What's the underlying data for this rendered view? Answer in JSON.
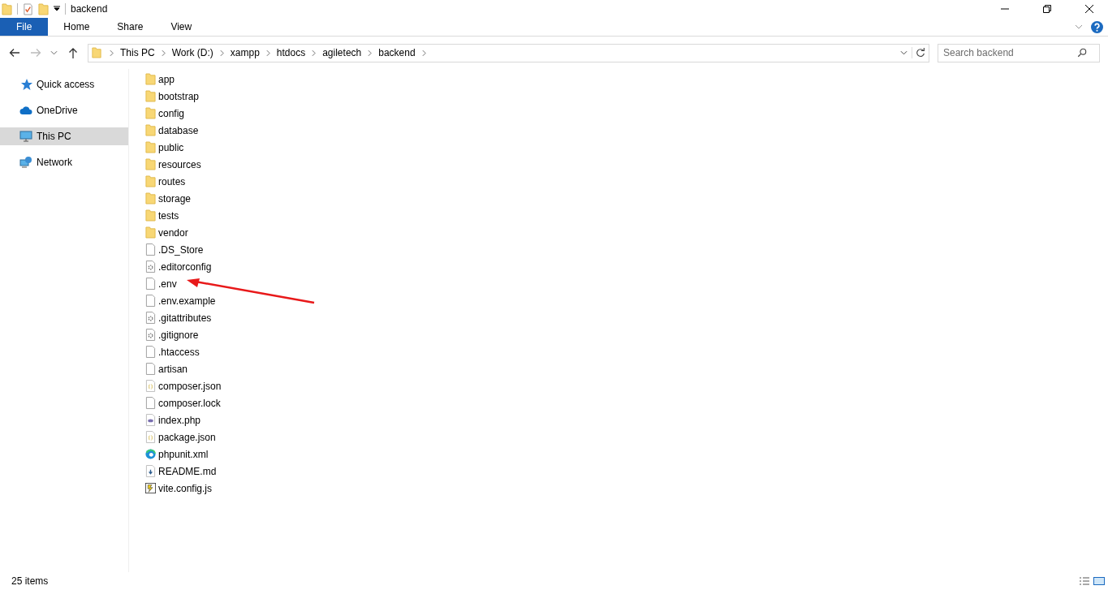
{
  "window": {
    "title": "backend"
  },
  "ribbon_tabs": [
    {
      "label": "File",
      "kind": "menu"
    },
    {
      "label": "Home",
      "kind": "tab"
    },
    {
      "label": "Share",
      "kind": "tab"
    },
    {
      "label": "View",
      "kind": "tab"
    }
  ],
  "address_bar": {
    "path": [
      "This PC",
      "Work (D:)",
      "xampp",
      "htdocs",
      "agiletech",
      "backend"
    ]
  },
  "search": {
    "placeholder": "Search backend"
  },
  "sidebar": {
    "items": [
      {
        "label": "Quick access",
        "kind": "star",
        "selected": false
      },
      {
        "label": "OneDrive",
        "kind": "cloud",
        "selected": false
      },
      {
        "label": "This PC",
        "kind": "computer",
        "selected": true
      },
      {
        "label": "Network",
        "kind": "network",
        "selected": false
      }
    ]
  },
  "files": [
    {
      "name": "app",
      "kind": "folder"
    },
    {
      "name": "bootstrap",
      "kind": "folder"
    },
    {
      "name": "config",
      "kind": "folder"
    },
    {
      "name": "database",
      "kind": "folder"
    },
    {
      "name": "public",
      "kind": "folder"
    },
    {
      "name": "resources",
      "kind": "folder"
    },
    {
      "name": "routes",
      "kind": "folder"
    },
    {
      "name": "storage",
      "kind": "folder"
    },
    {
      "name": "tests",
      "kind": "folder"
    },
    {
      "name": "vendor",
      "kind": "folder"
    },
    {
      "name": ".DS_Store",
      "kind": "file"
    },
    {
      "name": ".editorconfig",
      "kind": "settings"
    },
    {
      "name": ".env",
      "kind": "file"
    },
    {
      "name": ".env.example",
      "kind": "file"
    },
    {
      "name": ".gitattributes",
      "kind": "settings"
    },
    {
      "name": ".gitignore",
      "kind": "settings"
    },
    {
      "name": ".htaccess",
      "kind": "file"
    },
    {
      "name": "artisan",
      "kind": "file"
    },
    {
      "name": "composer.json",
      "kind": "json"
    },
    {
      "name": "composer.lock",
      "kind": "file"
    },
    {
      "name": "index.php",
      "kind": "php"
    },
    {
      "name": "package.json",
      "kind": "json"
    },
    {
      "name": "phpunit.xml",
      "kind": "browser"
    },
    {
      "name": "README.md",
      "kind": "markdown"
    },
    {
      "name": "vite.config.js",
      "kind": "script"
    }
  ],
  "status_bar": {
    "item_count": "25 items"
  }
}
